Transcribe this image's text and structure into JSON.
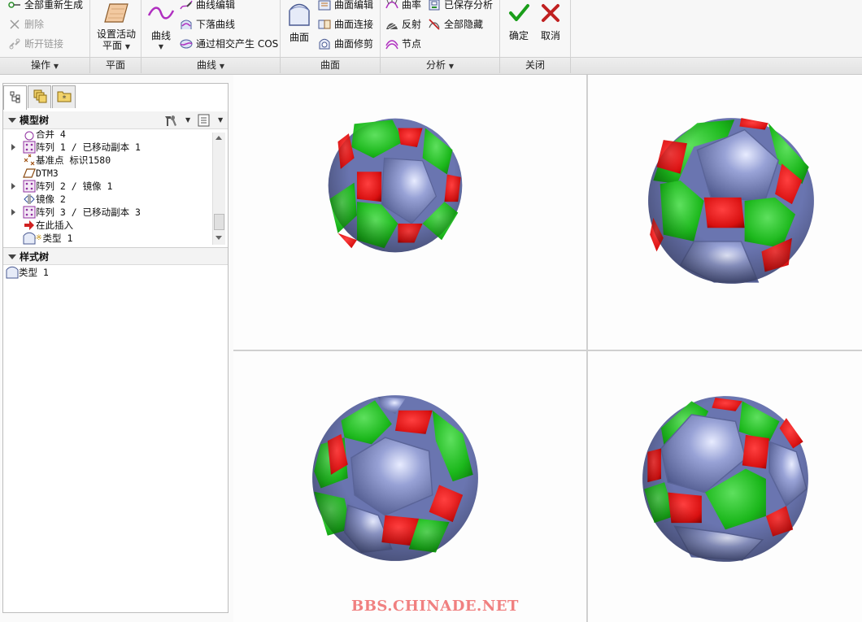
{
  "ribbon": {
    "ops": {
      "regen": "全部重新生成",
      "delete": "删除",
      "break_link": "断开链接",
      "group_label": "操作"
    },
    "plane": {
      "button_label_1": "设置活动",
      "button_label_2": "平面",
      "group_label": "平面"
    },
    "curve": {
      "curve_button": "曲线",
      "curve_edit": "曲线编辑",
      "drop_curve": "下落曲线",
      "cos": "通过相交产生 COS",
      "group_label": "曲线"
    },
    "surface": {
      "surface_button": "曲面",
      "surface_edit": "曲面编辑",
      "surface_connect": "曲面连接",
      "surface_trim": "曲面修剪",
      "group_label": "曲面"
    },
    "analysis": {
      "curvature": "曲率",
      "saved_analysis": "已保存分析",
      "reflection": "反射",
      "hide_all": "全部隐藏",
      "nodes": "节点",
      "group_label": "分析"
    },
    "close": {
      "ok": "确定",
      "cancel": "取消",
      "group_label": "关闭"
    }
  },
  "model_tree": {
    "header": "模型树",
    "items": [
      {
        "label": "合并 4"
      },
      {
        "label": "阵列 1 / 已移动副本 1"
      },
      {
        "label": "基准点 标识1580"
      },
      {
        "label": "DTM3"
      },
      {
        "label": "阵列 2 / 镜像 1"
      },
      {
        "label": "镜像 2"
      },
      {
        "label": "阵列 3 / 已移动副本 3"
      },
      {
        "label": "在此插入"
      },
      {
        "label": "类型 1"
      }
    ]
  },
  "style_tree": {
    "header": "样式树",
    "items": [
      {
        "label": "类型 1"
      }
    ]
  },
  "watermark": "BBS.CHINADE.NET",
  "colors": {
    "ball_blue": "#8d97cc",
    "ball_green": "#1fc01f",
    "ball_red": "#e01010",
    "ok_green": "#1a9e1a",
    "cancel_red": "#c02020"
  }
}
